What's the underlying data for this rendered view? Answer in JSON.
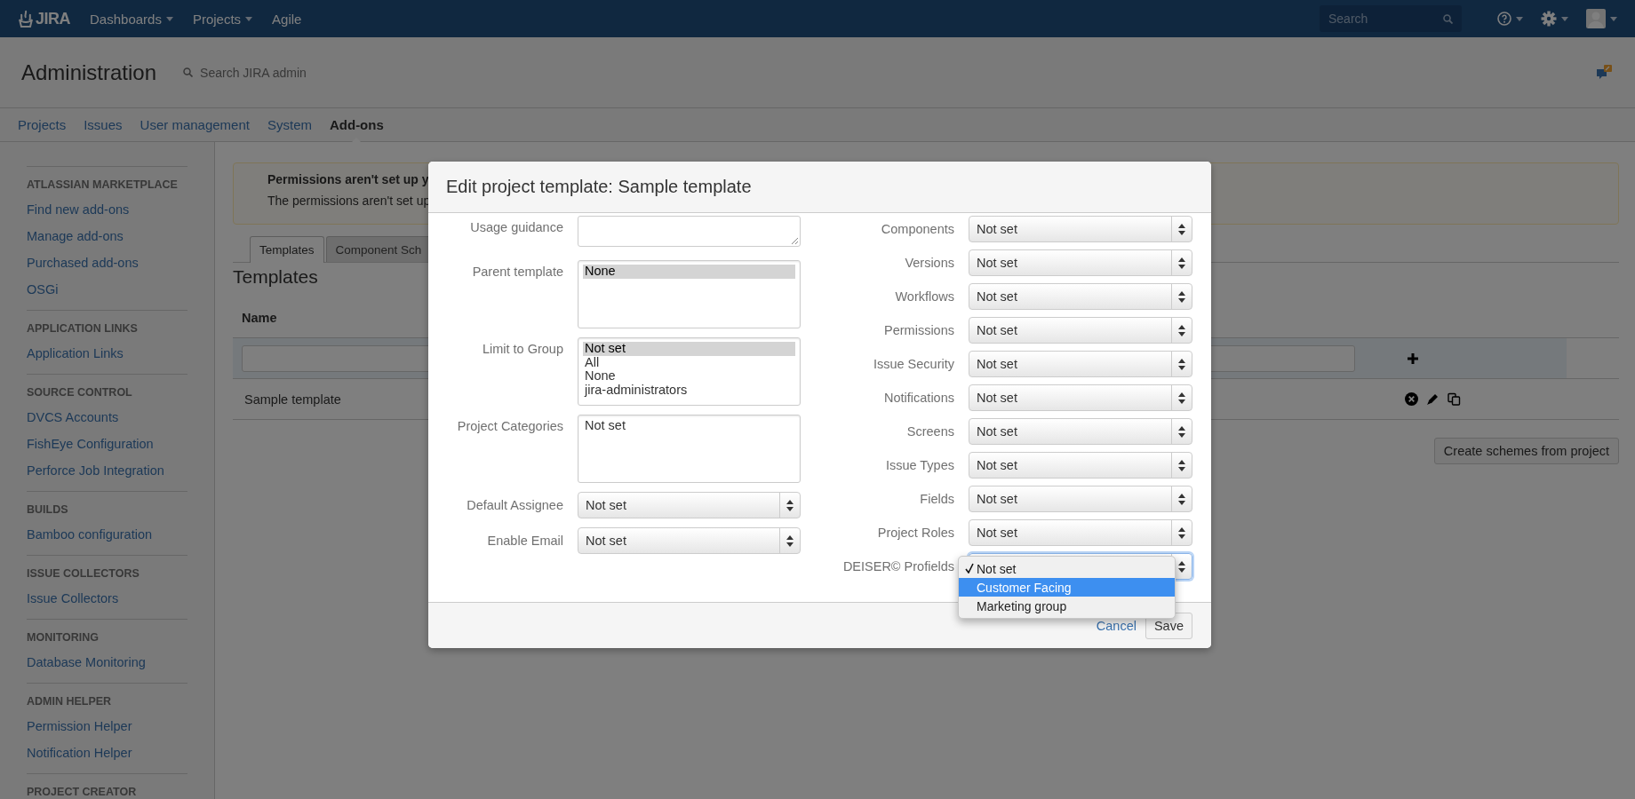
{
  "top_nav": {
    "logo": "JIRA",
    "menus": [
      {
        "label": "Dashboards"
      },
      {
        "label": "Projects"
      },
      {
        "label": "Agile"
      }
    ],
    "search": {
      "placeholder": "Search"
    }
  },
  "admin_header": {
    "title": "Administration",
    "search": {
      "placeholder": "Search JIRA admin"
    }
  },
  "admin_tabs": [
    {
      "label": "Projects",
      "selected": false
    },
    {
      "label": "Issues",
      "selected": false
    },
    {
      "label": "User management",
      "selected": false
    },
    {
      "label": "System",
      "selected": false
    },
    {
      "label": "Add-ons",
      "selected": true
    }
  ],
  "sidebar": {
    "sections": [
      {
        "heading": "ATLASSIAN MARKETPLACE",
        "items": [
          "Find new add-ons",
          "Manage add-ons",
          "Purchased add-ons",
          "OSGi"
        ]
      },
      {
        "heading": "APPLICATION LINKS",
        "items": [
          "Application Links"
        ]
      },
      {
        "heading": "SOURCE CONTROL",
        "items": [
          "DVCS Accounts",
          "FishEye Configuration",
          "Perforce Job Integration"
        ]
      },
      {
        "heading": "BUILDS",
        "items": [
          "Bamboo configuration"
        ]
      },
      {
        "heading": "ISSUE COLLECTORS",
        "items": [
          "Issue Collectors"
        ]
      },
      {
        "heading": "MONITORING",
        "items": [
          "Database Monitoring"
        ]
      },
      {
        "heading": "ADMIN HELPER",
        "items": [
          "Permission Helper",
          "Notification Helper"
        ]
      },
      {
        "heading": "PROJECT CREATOR"
      }
    ]
  },
  "content": {
    "warning": {
      "title": "Permissions aren't set up y",
      "text": "The permissions aren't set up"
    },
    "tabs": [
      {
        "label": "Templates",
        "selected": true
      },
      {
        "label": "Component Sch",
        "selected": false
      }
    ],
    "heading": "Templates",
    "table": {
      "columns": [
        "Name"
      ],
      "rows": [
        {
          "name": "Sample template"
        }
      ]
    },
    "button": "Create schemes from project"
  },
  "dialog": {
    "title": "Edit project template: Sample template",
    "left_fields": [
      {
        "label": "Usage guidance",
        "kind": "textarea"
      },
      {
        "label": "Parent template",
        "kind": "listbox",
        "options": [
          {
            "label": "None",
            "selected": true
          }
        ]
      },
      {
        "label": "Limit to Group",
        "kind": "listbox",
        "options": [
          {
            "label": "Not set",
            "selected": true
          },
          {
            "label": "All",
            "selected": false
          },
          {
            "label": "None",
            "selected": false
          },
          {
            "label": "jira-administrators",
            "selected": false
          }
        ]
      },
      {
        "label": "Project Categories",
        "kind": "listbox",
        "options": [
          {
            "label": "Not set",
            "selected": false
          }
        ]
      },
      {
        "label": "Default Assignee",
        "kind": "select",
        "value": "Not set"
      },
      {
        "label": "Enable Email",
        "kind": "select",
        "value": "Not set"
      }
    ],
    "right_fields": [
      {
        "label": "Components",
        "value": "Not set",
        "focused": false
      },
      {
        "label": "Versions",
        "value": "Not set",
        "focused": false
      },
      {
        "label": "Workflows",
        "value": "Not set",
        "focused": false
      },
      {
        "label": "Permissions",
        "value": "Not set",
        "focused": false
      },
      {
        "label": "Issue Security",
        "value": "Not set",
        "focused": false
      },
      {
        "label": "Notifications",
        "value": "Not set",
        "focused": false
      },
      {
        "label": "Screens",
        "value": "Not set",
        "focused": false
      },
      {
        "label": "Issue Types",
        "value": "Not set",
        "focused": false
      },
      {
        "label": "Fields",
        "value": "Not set",
        "focused": false
      },
      {
        "label": "Project Roles",
        "value": "Not set",
        "focused": false
      },
      {
        "label": "DEISER© Profields",
        "focused": true
      }
    ],
    "dropdown": {
      "options": [
        {
          "label": "Not set",
          "checked": true,
          "highlighted": false
        },
        {
          "label": "Customer Facing",
          "checked": false,
          "highlighted": true
        },
        {
          "label": "Marketing group",
          "checked": false,
          "highlighted": false
        }
      ]
    },
    "cancel": "Cancel",
    "save": "Save"
  }
}
